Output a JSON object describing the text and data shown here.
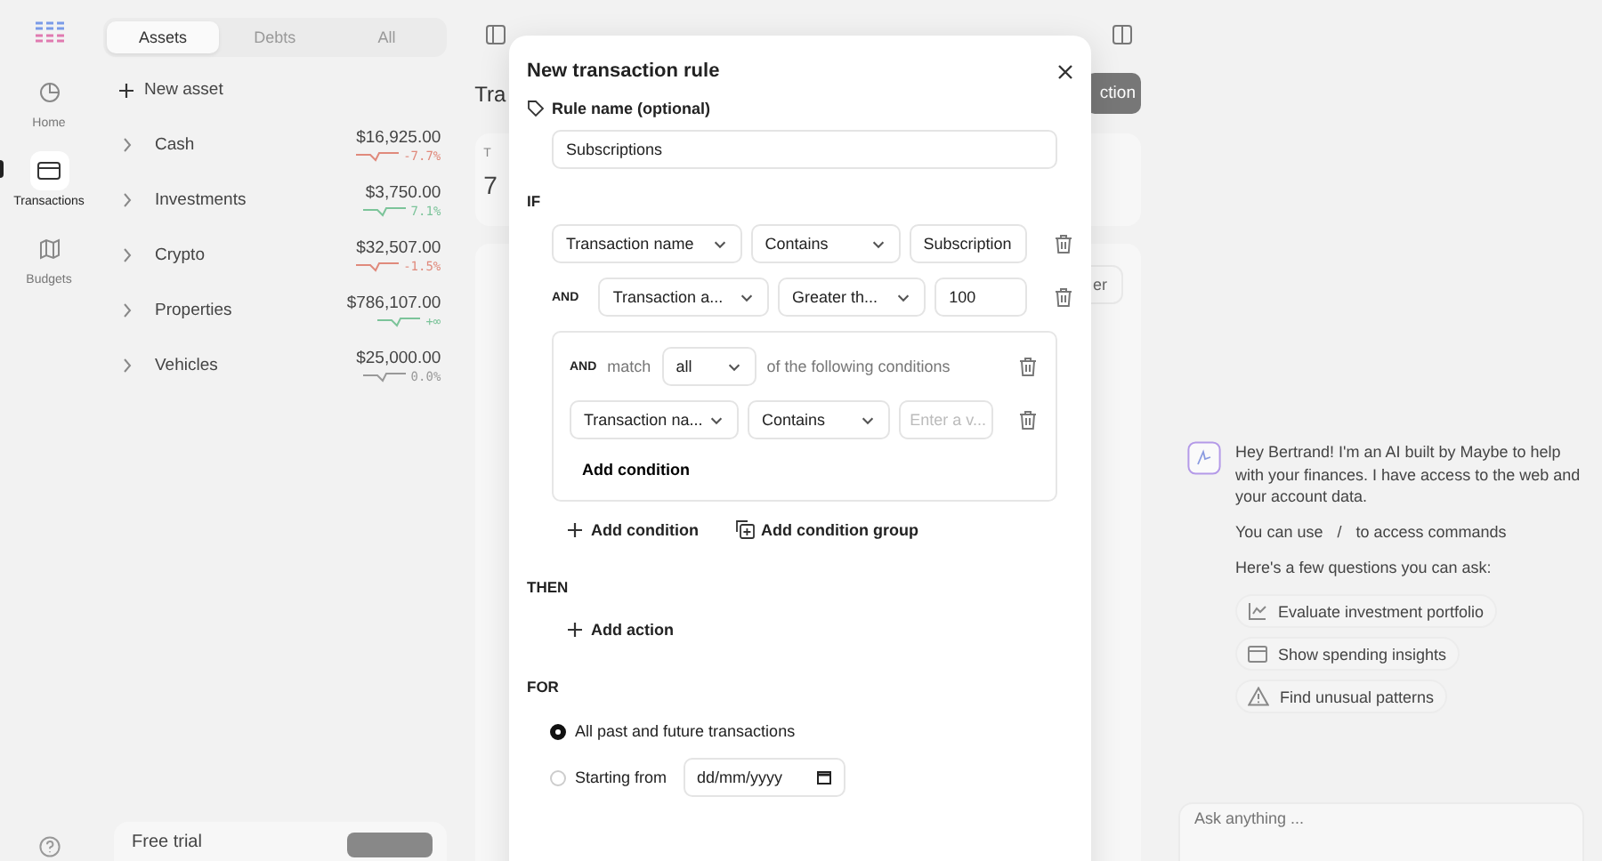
{
  "nav": {
    "items": [
      {
        "label": "Home",
        "selected": false
      },
      {
        "label": "Transactions",
        "selected": true
      },
      {
        "label": "Budgets",
        "selected": false
      }
    ]
  },
  "sidebar": {
    "tabs": [
      {
        "label": "Assets",
        "selected": true
      },
      {
        "label": "Debts",
        "selected": false
      },
      {
        "label": "All",
        "selected": false
      }
    ],
    "new_button": "New asset",
    "accounts": [
      {
        "name": "Cash",
        "amount": "$16,925.00",
        "change": "-7.7%",
        "color": "#e08a7c"
      },
      {
        "name": "Investments",
        "amount": "$3,750.00",
        "change": "7.1%",
        "color": "#7cc49a"
      },
      {
        "name": "Crypto",
        "amount": "$32,507.00",
        "change": "-1.5%",
        "color": "#e08a7c"
      },
      {
        "name": "Properties",
        "amount": "$786,107.00",
        "change": "+∞",
        "color": "#7cc49a"
      },
      {
        "name": "Vehicles",
        "amount": "$25,000.00",
        "change": "0.0%",
        "color": "#999999"
      }
    ],
    "trial": {
      "label": "Free trial"
    }
  },
  "main": {
    "title": "Tra",
    "action_button": "ction",
    "summary_value": "7",
    "summary_label": "T",
    "filter_button": "er"
  },
  "modal": {
    "title": "New transaction rule",
    "name_label": "Rule name (optional)",
    "name_value": "Subscriptions",
    "if_label": "IF",
    "conditions": [
      {
        "kind": "condition",
        "field": "Transaction name",
        "operator": "Contains",
        "value": "Subscription"
      },
      {
        "kind": "condition",
        "connector": "AND",
        "field": "Transaction a...",
        "operator": "Greater th...",
        "value": "100"
      },
      {
        "kind": "group",
        "connector": "AND",
        "match_label": "match",
        "match_value": "all",
        "suffix": "of the following conditions",
        "add_label": "Add condition",
        "conditions": [
          {
            "kind": "condition",
            "field": "Transaction na...",
            "operator": "Contains",
            "placeholder": "Enter a v..."
          }
        ]
      }
    ],
    "add_condition": "Add condition",
    "add_group": "Add condition group",
    "then_label": "THEN",
    "add_action": "Add action",
    "for_label": "FOR",
    "scope": [
      {
        "label": "All past and future transactions",
        "selected": true
      },
      {
        "label": "Starting from",
        "selected": false,
        "date_placeholder": "dd/mm/yyyy"
      }
    ]
  },
  "chat": {
    "greeting": "Hey Bertrand! I'm an AI built by Maybe to help with your finances. I have access to the web and your account data.",
    "commands_prefix": "You can use",
    "commands_key": "/",
    "commands_suffix": "to access commands",
    "questions_intro": "Here's a few questions you can ask:",
    "suggestions": [
      {
        "label": "Evaluate investment portfolio",
        "kind": "chart"
      },
      {
        "label": "Show spending insights",
        "kind": "wallet"
      },
      {
        "label": "Find unusual patterns",
        "kind": "warning"
      }
    ],
    "input": {
      "placeholder": "Ask anything ..."
    }
  }
}
